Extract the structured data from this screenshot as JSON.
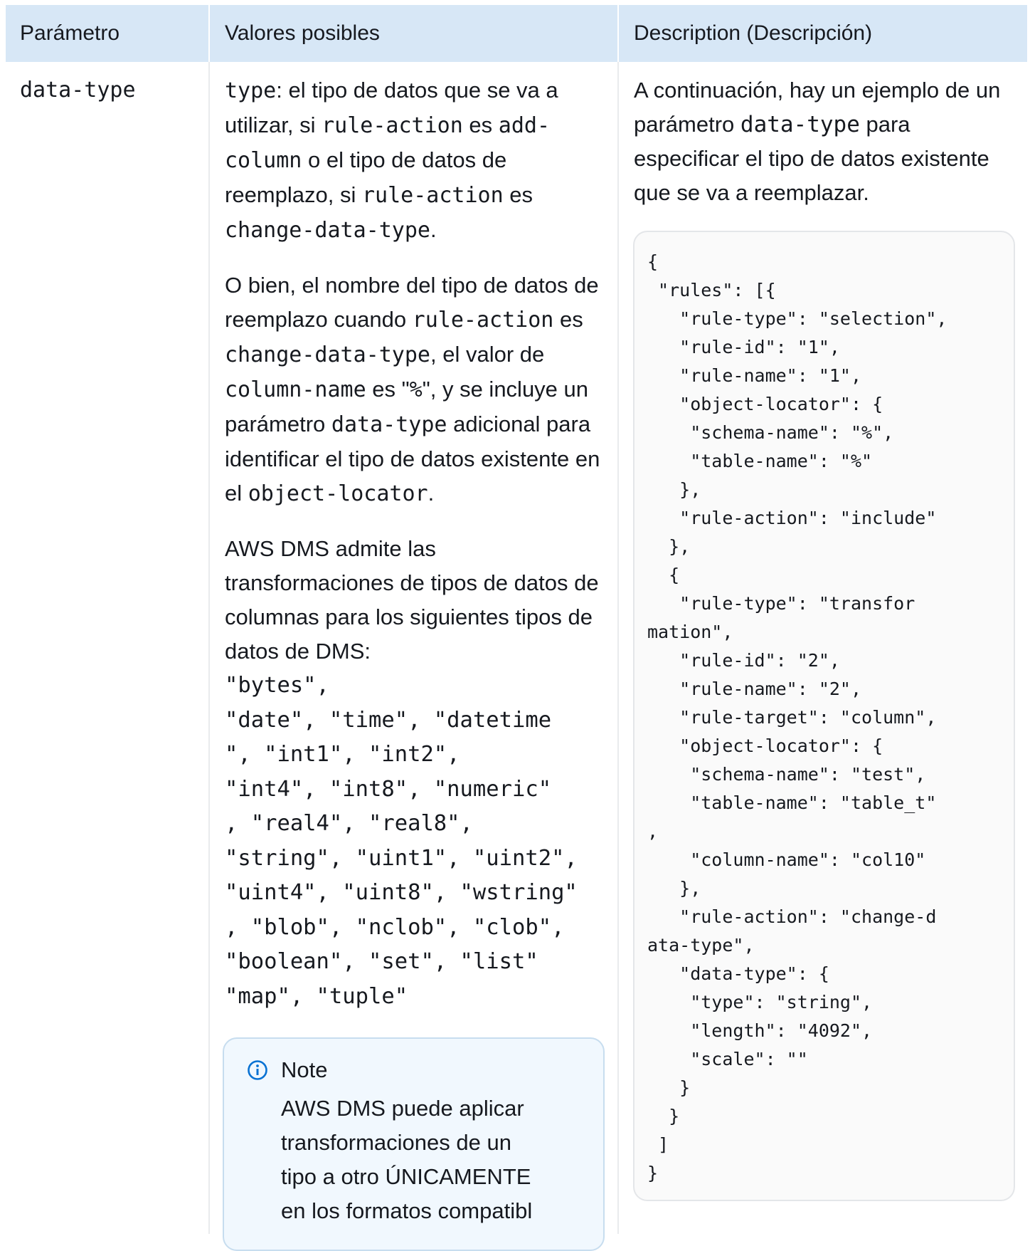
{
  "table": {
    "headers": [
      "Parámetro",
      "Valores posibles",
      "Description (Descripción)"
    ]
  },
  "row": {
    "parameter": "data-type",
    "values_col": {
      "p1": {
        "c1": "type",
        "t1": ": el tipo de datos que se va a utilizar, si ",
        "c2": "rule-action",
        "t2": " es ",
        "c3": "add-column",
        "t3": " o el tipo de datos de reemplazo, si ",
        "c4": "rule-action",
        "t4": " es ",
        "c5": "change-data-type",
        "t5": "."
      },
      "p2": {
        "t1": "O bien, el nombre del tipo de datos de reemplazo cuando ",
        "c1": "rule-action",
        "t2": " es ",
        "c2": "change-data-type",
        "t3": ", el valor de ",
        "c3": "column-name",
        "t4": " es \"",
        "c4": "%",
        "t5": "\", y se incluye un parámetro ",
        "c5": "data-type",
        "t6": " adicional para identificar el tipo de datos existente en el ",
        "c6": "object-locator",
        "t7": "."
      },
      "p3_text": "AWS DMS admite las transformaciones de tipos de datos de columnas para los siguientes tipos de datos de DMS: ",
      "p3_types": "\"bytes\",\n\"date\", \"time\", \"datetime\n\", \"int1\", \"int2\",\n\"int4\", \"int8\", \"numeric\"\n, \"real4\", \"real8\",\n\"string\", \"uint1\", \"uint2\",\n\"uint4\", \"uint8\", \"wstring\"\n, \"blob\", \"nclob\", \"clob\",\n\"boolean\", \"set\", \"list\"\n\"map\", \"tuple\"",
      "note": {
        "title": "Note",
        "body": "AWS DMS puede aplicar\ntransformaciones de un\ntipo a otro ÚNICAMENTE\nen los formatos compatibl",
        "icon": "info-icon"
      }
    },
    "description_col": {
      "t1": "A continuación, hay un ejemplo de un parámetro ",
      "c1": "data-type",
      "t2": " para especificar el tipo de datos existente que se va a reemplazar.",
      "code": "{\n \"rules\": [{\n   \"rule-type\": \"selection\",\n   \"rule-id\": \"1\",\n   \"rule-name\": \"1\",\n   \"object-locator\": {\n    \"schema-name\": \"%\",\n    \"table-name\": \"%\"\n   },\n   \"rule-action\": \"include\"\n  },\n  {\n   \"rule-type\": \"transfor\nmation\",\n   \"rule-id\": \"2\",\n   \"rule-name\": \"2\",\n   \"rule-target\": \"column\",\n   \"object-locator\": {\n    \"schema-name\": \"test\",\n    \"table-name\": \"table_t\"\n,\n    \"column-name\": \"col10\"\n   },\n   \"rule-action\": \"change-d\nata-type\",\n   \"data-type\": {\n    \"type\": \"string\",\n    \"length\": \"4092\",\n    \"scale\": \"\"\n   }\n  }\n ]\n}"
    }
  },
  "colors": {
    "header_bg": "#d7e7f6",
    "note_bg": "#f1f8fe",
    "note_icon": "#0972d3",
    "code_bg": "#fafafa"
  }
}
